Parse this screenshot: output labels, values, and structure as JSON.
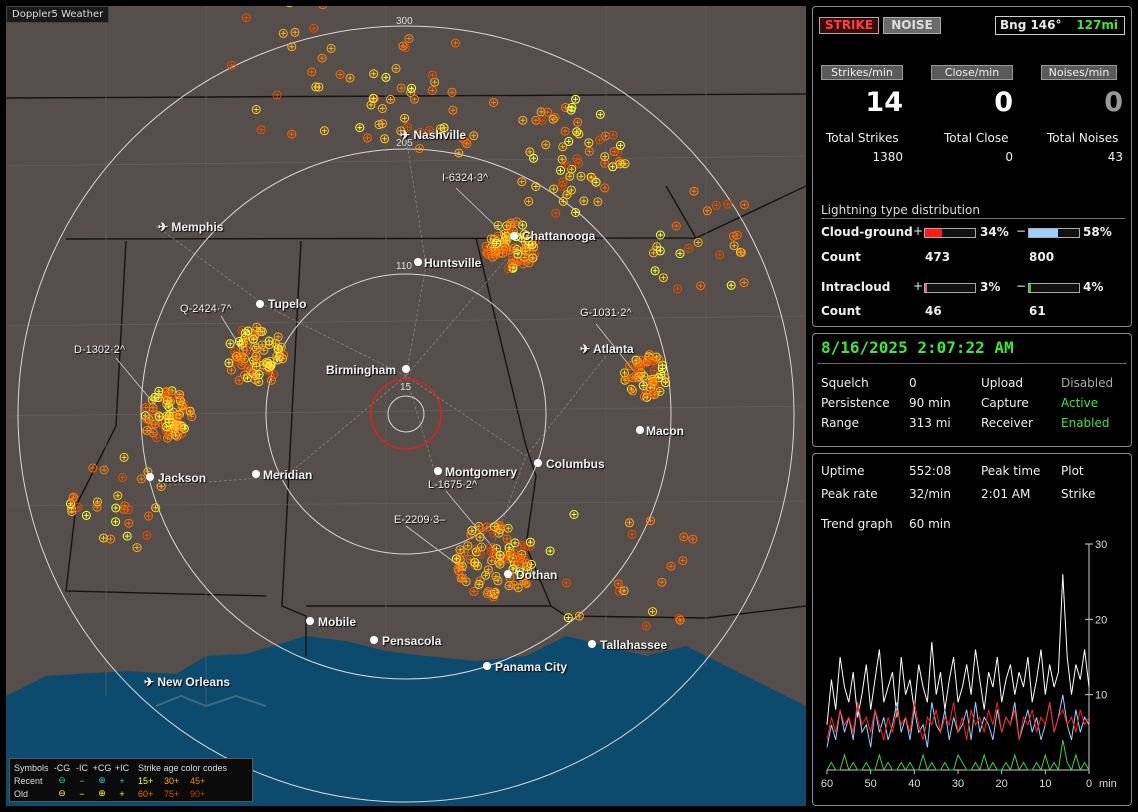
{
  "app_title": "Doppler5 Weather",
  "map": {
    "cities": [
      {
        "name": "Nashville"
      },
      {
        "name": "Memphis"
      },
      {
        "name": "Chattanooga"
      },
      {
        "name": "Huntsville"
      },
      {
        "name": "Tupelo"
      },
      {
        "name": "Birmingham"
      },
      {
        "name": "Atlanta"
      },
      {
        "name": "Macon"
      },
      {
        "name": "Jackson"
      },
      {
        "name": "Meridian"
      },
      {
        "name": "Montgomery"
      },
      {
        "name": "Columbus"
      },
      {
        "name": "Dothan"
      },
      {
        "name": "Mobile"
      },
      {
        "name": "Pensacola"
      },
      {
        "name": "Tallahassee"
      },
      {
        "name": "Panama City"
      },
      {
        "name": "New Orleans"
      }
    ],
    "storms": [
      "I-6324",
      "Q-2424",
      "D-1302",
      "G-1031",
      "L-1675",
      "E-2209"
    ],
    "range_labels": [
      "300",
      "205",
      "110",
      "15"
    ]
  },
  "legend": {
    "header": [
      "Symbols",
      "-CG",
      "-IC",
      "+CG",
      "+IC",
      "Strike age color codes"
    ],
    "recent_label": "Recent",
    "old_label": "Old",
    "recent_ages": [
      "15+",
      "30+",
      "45+"
    ],
    "old_ages": [
      "60+",
      "75+",
      "90+"
    ],
    "age_colors": {
      "15": "#ffff40",
      "30": "#ffb020",
      "45": "#ff8010",
      "60": "#ff6a00",
      "75": "#e05000",
      "90": "#c04000"
    }
  },
  "panel1": {
    "strike_btn": "STRIKE",
    "noise_btn": "NOISE",
    "bearing": "Bng 146°",
    "distance": "127mi",
    "headers": [
      "Strikes/min",
      "Close/min",
      "Noises/min"
    ],
    "rates": [
      "14",
      "0",
      "0"
    ],
    "total_labels": [
      "Total Strikes",
      "Total Close",
      "Total Noises"
    ],
    "totals": [
      "1380",
      "0",
      "43"
    ],
    "distribution_title": "Lightning type distribution",
    "cloud_ground_label": "Cloud-ground",
    "intracloud_label": "Intracloud",
    "count_label": "Count",
    "plus": "+",
    "minus": "−",
    "cg_pos_pct": "34%",
    "cg_neg_pct": "58%",
    "cg_pos_count": "473",
    "cg_neg_count": "800",
    "ic_pos_pct": "3%",
    "ic_neg_pct": "4%",
    "ic_pos_count": "46",
    "ic_neg_count": "61",
    "fills": {
      "cg_pos": 0.34,
      "cg_neg": 0.58,
      "ic_pos": 0.03,
      "ic_neg": 0.04
    },
    "colors": {
      "cg_pos": "#ff1a1a",
      "cg_neg": "#9ccfff",
      "ic_pos": "#e060a0",
      "ic_neg": "#40c040",
      "noise_dim": "#999999"
    }
  },
  "panel2": {
    "datetime": "8/16/2025 2:07:22 AM",
    "squelch_label": "Squelch",
    "squelch": "0",
    "persistence_label": "Persistence",
    "persistence": "90 min",
    "range_label": "Range",
    "range": "313 mi",
    "upload_label": "Upload",
    "upload": "Disabled",
    "capture_label": "Capture",
    "capture": "Active",
    "receiver_label": "Receiver",
    "receiver": "Enabled"
  },
  "panel3": {
    "uptime_label": "Uptime",
    "uptime": "552:08",
    "peak_time_label": "Peak time",
    "plot_label": "Plot",
    "peak_rate_label": "Peak rate",
    "peak_rate": "32/min",
    "peak_time": "2:01 AM",
    "plot": "Strike",
    "trend_label": "Trend graph",
    "trend": "60 min"
  },
  "chart_data": {
    "type": "line",
    "x_label_unit": "min",
    "x_ticks": [
      "60",
      "50",
      "40",
      "30",
      "20",
      "10",
      "0"
    ],
    "y_ticks": [
      "30",
      "20",
      "10"
    ],
    "ylim": [
      0,
      30
    ],
    "x": [
      60,
      59,
      58,
      57,
      56,
      55,
      54,
      53,
      52,
      51,
      50,
      49,
      48,
      47,
      46,
      45,
      44,
      43,
      42,
      41,
      40,
      39,
      38,
      37,
      36,
      35,
      34,
      33,
      32,
      31,
      30,
      29,
      28,
      27,
      26,
      25,
      24,
      23,
      22,
      21,
      20,
      19,
      18,
      17,
      16,
      15,
      14,
      13,
      12,
      11,
      10,
      9,
      8,
      7,
      6,
      5,
      4,
      3,
      2,
      1,
      0
    ],
    "series": [
      {
        "color": "#ffffff",
        "values": [
          6,
          12,
          8,
          15,
          11,
          9,
          13,
          7,
          10,
          14,
          8,
          12,
          16,
          9,
          11,
          13,
          7,
          15,
          10,
          12,
          8,
          14,
          11,
          9,
          17,
          10,
          13,
          8,
          12,
          15,
          9,
          11,
          14,
          10,
          16,
          12,
          8,
          13,
          11,
          15,
          9,
          12,
          14,
          10,
          13,
          11,
          15,
          9,
          12,
          16,
          10,
          14,
          11,
          13,
          26,
          15,
          10,
          14,
          12,
          16,
          11
        ]
      },
      {
        "color": "#9ccfff",
        "values": [
          3,
          6,
          4,
          8,
          5,
          7,
          4,
          9,
          5,
          6,
          3,
          8,
          5,
          7,
          4,
          6,
          9,
          5,
          7,
          4,
          8,
          5,
          6,
          3,
          9,
          6,
          5,
          8,
          4,
          7,
          5,
          6,
          8,
          4,
          9,
          5,
          7,
          6,
          4,
          8,
          5,
          7,
          6,
          9,
          4,
          6,
          8,
          5,
          7,
          4,
          6,
          9,
          5,
          7,
          10,
          6,
          4,
          8,
          5,
          7,
          6
        ]
      },
      {
        "color": "#ff2020",
        "values": [
          4,
          7,
          5,
          8,
          6,
          7,
          5,
          9,
          6,
          7,
          5,
          8,
          6,
          4,
          7,
          5,
          8,
          6,
          7,
          5,
          9,
          6,
          4,
          7,
          6,
          8,
          5,
          7,
          6,
          9,
          5,
          7,
          4,
          8,
          6,
          7,
          5,
          8,
          6,
          9,
          5,
          7,
          6,
          8,
          4,
          7,
          6,
          8,
          5,
          7,
          6,
          9,
          5,
          7,
          8,
          6,
          7,
          5,
          8,
          6,
          7
        ]
      },
      {
        "color": "#40d040",
        "values": [
          0,
          1,
          0,
          0,
          2,
          0,
          1,
          0,
          0,
          1,
          0,
          0,
          2,
          0,
          1,
          0,
          0,
          1,
          0,
          1,
          0,
          0,
          2,
          0,
          1,
          0,
          0,
          1,
          0,
          0,
          2,
          1,
          0,
          0,
          1,
          0,
          2,
          0,
          1,
          0,
          0,
          1,
          0,
          2,
          0,
          1,
          0,
          0,
          1,
          0,
          2,
          0,
          1,
          0,
          4,
          1,
          0,
          2,
          0,
          1,
          0
        ]
      }
    ]
  }
}
